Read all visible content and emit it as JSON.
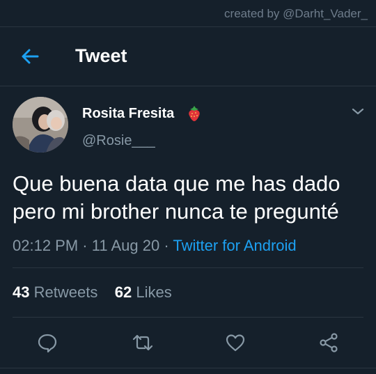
{
  "watermark": "created by @Darht_Vader_",
  "header": {
    "title": "Tweet",
    "back_icon": "arrow-left-icon"
  },
  "tweet": {
    "display_name": "Rosita Fresita",
    "badge_icon": "strawberry-icon",
    "handle": "@Rosie___",
    "text_line1": "Que buena data que me has dado",
    "text_line2": "pero mi brother nunca te pregunté",
    "time": "02:12 PM",
    "date": "11 Aug 20",
    "source": "Twitter for Android",
    "separator": " · "
  },
  "stats": {
    "retweets_count": "43",
    "retweets_label": "Retweets",
    "likes_count": "62",
    "likes_label": "Likes"
  },
  "colors": {
    "background": "#15202b",
    "accent": "#1da1f2",
    "muted": "#8899a6",
    "divider": "#2a3540"
  },
  "actions": [
    "reply-icon",
    "retweet-icon",
    "like-icon",
    "share-icon"
  ]
}
